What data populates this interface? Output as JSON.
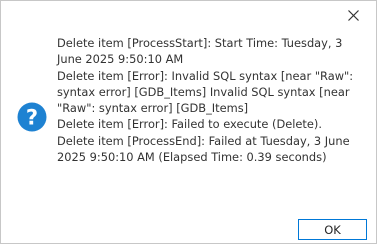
{
  "dialog": {
    "close_icon": "close-icon",
    "message_icon": "question-icon",
    "message_lines": [
      "Delete item [ProcessStart]: Start Time: Tuesday, 3 June 2025 9:50:10 AM",
      "Delete item [Error]: Invalid SQL syntax [near \"Raw\": syntax error] [GDB_Items] Invalid SQL syntax [near \"Raw\": syntax error] [GDB_Items]",
      "Delete item [Error]: Failed to execute (Delete).",
      "Delete item [ProcessEnd]: Failed at Tuesday, 3 June 2025 9:50:10 AM (Elapsed Time: 0.39 seconds)"
    ],
    "ok_label": "OK"
  },
  "colors": {
    "accent": "#0078d7",
    "question_icon": "#1e82d2",
    "text": "#333333"
  }
}
